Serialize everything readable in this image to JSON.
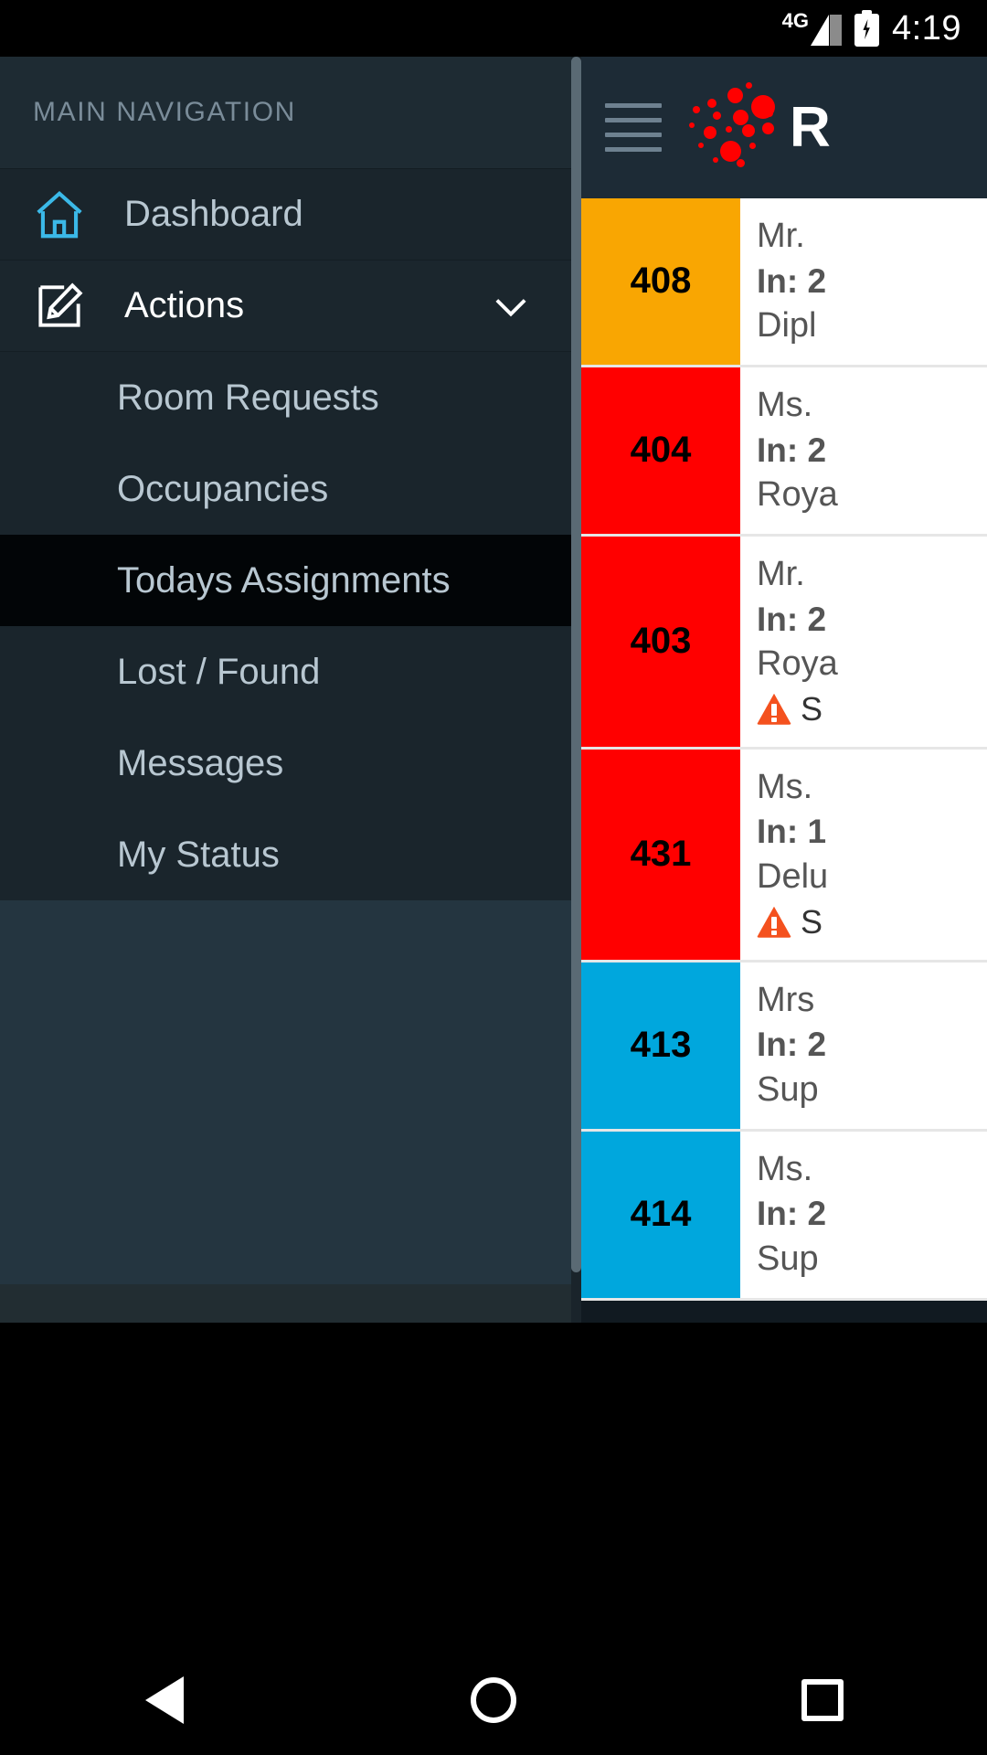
{
  "status_bar": {
    "network": "4G",
    "time": "4:19",
    "battery_icon": "battery-charging-icon",
    "signal_icon": "signal-bars-icon"
  },
  "app_bar": {
    "menu_icon": "hamburger-menu-icon",
    "logo_icon": "red-dots-cluster-logo",
    "brand_text": "R"
  },
  "drawer": {
    "header": "MAIN NAVIGATION",
    "items": [
      {
        "label": "Dashboard",
        "icon": "home-icon"
      },
      {
        "label": "Actions",
        "icon": "pencil-edit-icon",
        "expander": "chevron-down-icon"
      }
    ],
    "sub_items": [
      {
        "label": "Room Requests",
        "active": false
      },
      {
        "label": "Occupancies",
        "active": false
      },
      {
        "label": "Todays Assignments",
        "active": true
      },
      {
        "label": "Lost / Found",
        "active": false
      },
      {
        "label": "Messages",
        "active": false
      },
      {
        "label": "My Status",
        "active": false
      }
    ]
  },
  "colors": {
    "status_orange": "#f9a602",
    "status_red": "#ff0000",
    "status_blue": "#00a7dd",
    "alert_orange": "#f4511e",
    "drawer_bg": "#1a252c",
    "active_bg": "#020507",
    "brand_red": "#ff0000"
  },
  "room_list": [
    {
      "room": "408",
      "color": "#f9a602",
      "guest": "Mr.",
      "check_in_label": "In:",
      "check_in_value": "2",
      "room_type": "Dipl",
      "alert": null
    },
    {
      "room": "404",
      "color": "#ff0000",
      "guest": "Ms.",
      "check_in_label": "In:",
      "check_in_value": "2",
      "room_type": "Roya",
      "alert": null
    },
    {
      "room": "403",
      "color": "#ff0000",
      "guest": "Mr.",
      "check_in_label": "In:",
      "check_in_value": "2",
      "room_type": "Roya",
      "alert": "S"
    },
    {
      "room": "431",
      "color": "#ff0000",
      "guest": "Ms.",
      "check_in_label": "In:",
      "check_in_value": "1",
      "room_type": "Delu",
      "alert": "S"
    },
    {
      "room": "413",
      "color": "#00a7dd",
      "guest": "Mrs",
      "check_in_label": "In:",
      "check_in_value": "2",
      "room_type": "Sup",
      "alert": null
    },
    {
      "room": "414",
      "color": "#00a7dd",
      "guest": "Ms.",
      "check_in_label": "In:",
      "check_in_value": "2",
      "room_type": "Sup",
      "alert": null
    }
  ],
  "bottom_nav": [
    {
      "icon": "back-triangle-icon"
    },
    {
      "icon": "home-circle-icon"
    },
    {
      "icon": "recents-square-icon"
    }
  ]
}
